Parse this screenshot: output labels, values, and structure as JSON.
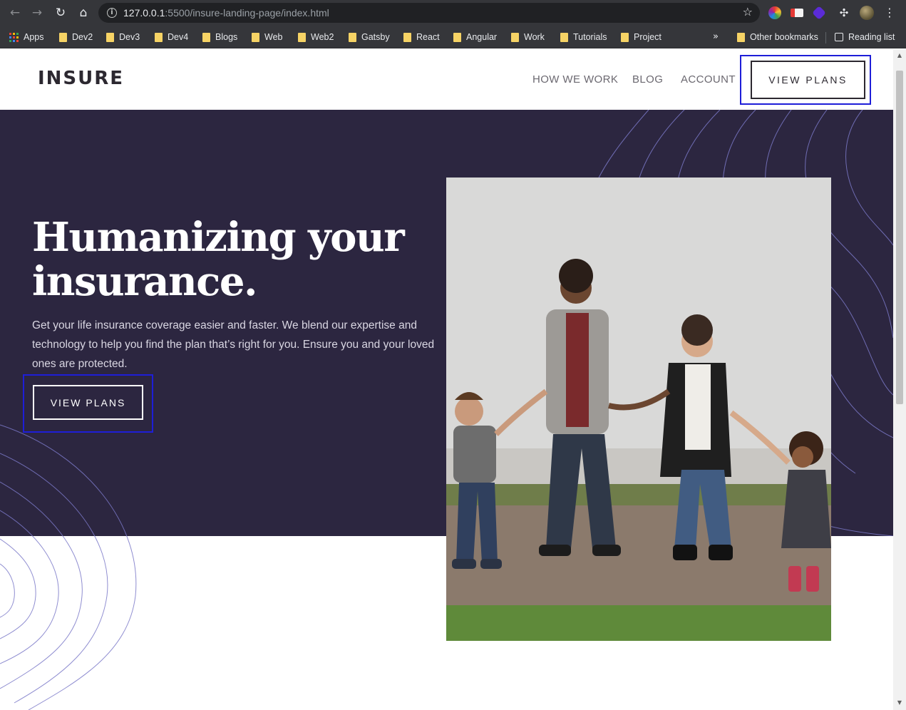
{
  "browser": {
    "url_host": "127.0.0.1",
    "url_rest": ":5500/insure-landing-page/index.html",
    "bookmarks": [
      "Apps",
      "Dev2",
      "Dev3",
      "Dev4",
      "Blogs",
      "Web",
      "Web2",
      "Gatsby",
      "React",
      "Angular",
      "Work",
      "Tutorials",
      "Project"
    ],
    "overflow_label": "»",
    "other_bookmarks": "Other bookmarks",
    "reading_list": "Reading list"
  },
  "header": {
    "logo": "INSURE",
    "nav": [
      "HOW WE WORK",
      "BLOG",
      "ACCOUNT"
    ],
    "cta": "VIEW PLANS"
  },
  "hero": {
    "title_line1": "Humanizing your",
    "title_line2": "insurance.",
    "text": "Get your life insurance coverage easier and faster. We blend our expertise and technology to help you find the plan that’s right for you. Ensure you and your loved ones are protected.",
    "cta": "VIEW PLANS"
  },
  "colors": {
    "hero_bg": "#2c2640",
    "dark_text": "#2c2830",
    "nav_text": "#6b6870",
    "highlight": "#1e1ed8",
    "pattern_line": "#7b79c8"
  },
  "icons": {
    "back": "back-arrow-icon",
    "forward": "forward-arrow-icon",
    "reload": "reload-icon",
    "home": "home-icon",
    "info": "info-icon",
    "bookmark": "star-icon",
    "extensions": "puzzle-icon",
    "menu": "kebab-menu-icon"
  }
}
